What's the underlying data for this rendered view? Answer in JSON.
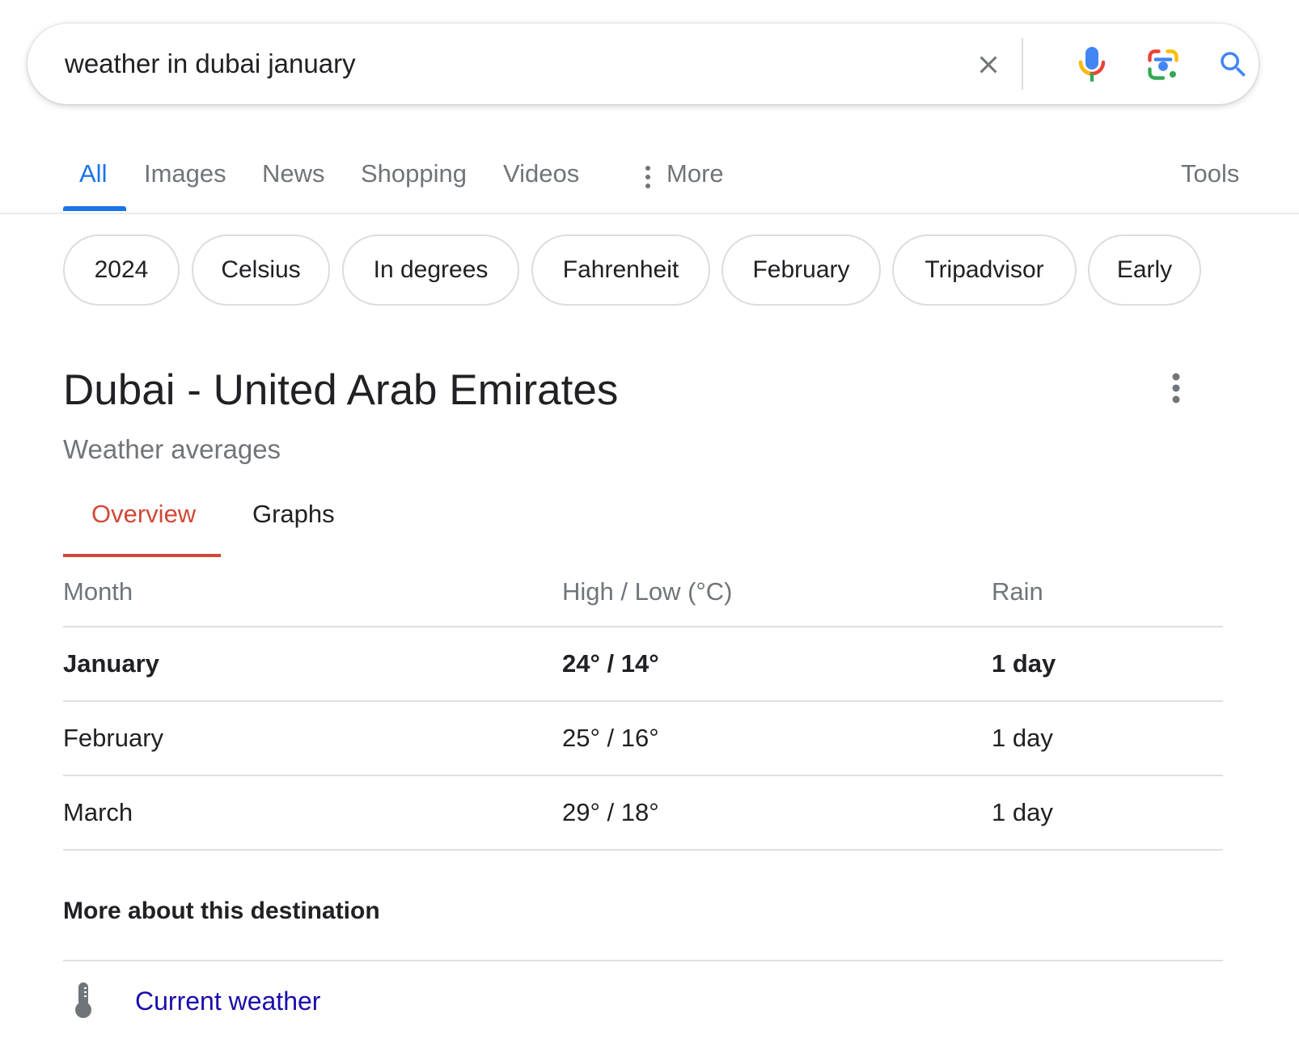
{
  "search": {
    "query": "weather in dubai january",
    "clear_icon": "close-icon",
    "mic_icon": "mic-icon",
    "lens_icon": "lens-icon",
    "search_icon": "search-icon"
  },
  "nav": {
    "tabs": [
      {
        "label": "All",
        "active": true
      },
      {
        "label": "Images"
      },
      {
        "label": "News"
      },
      {
        "label": "Shopping"
      },
      {
        "label": "Videos"
      },
      {
        "label": "More"
      }
    ],
    "tools": "Tools",
    "active_color": "#1a73e8"
  },
  "chips": [
    "2024",
    "Celsius",
    "In degrees",
    "Fahrenheit",
    "February",
    "Tripadvisor",
    "Early"
  ],
  "card": {
    "title": "Dubai - United Arab Emirates",
    "subtitle": "Weather averages",
    "tabs": [
      {
        "label": "Overview",
        "active": true
      },
      {
        "label": "Graphs"
      }
    ],
    "accent_color": "#d14836",
    "table": {
      "headers": [
        "Month",
        "High / Low (°C)",
        "Rain"
      ],
      "rows": [
        {
          "month": "January",
          "high_low": "24° / 14°",
          "rain": "1 day",
          "highlight": true
        },
        {
          "month": "February",
          "high_low": "25° / 16°",
          "rain": "1 day"
        },
        {
          "month": "March",
          "high_low": "29° / 18°",
          "rain": "1 day"
        }
      ]
    },
    "more_heading": "More about this destination",
    "links": [
      {
        "icon": "thermometer-icon",
        "label": "Current weather"
      }
    ],
    "link_color": "#1a0dab"
  }
}
